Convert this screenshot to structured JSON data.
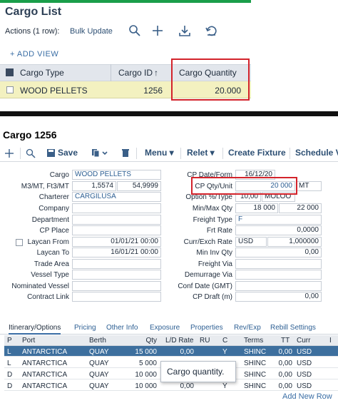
{
  "top": {
    "title": "Cargo List",
    "actions_label": "Actions (1 row):",
    "bulk_update": "Bulk Update",
    "add_view": "+ ADD VIEW",
    "columns": {
      "cargo_type": "Cargo Type",
      "cargo_id": "Cargo ID",
      "cargo_quantity": "Cargo Quantity"
    },
    "sort_indicator": "↑",
    "row": {
      "cargo_type": "WOOD PELLETS",
      "cargo_id": "1256",
      "cargo_quantity": "20.000"
    }
  },
  "bottom": {
    "title": "Cargo 1256",
    "toolbar": {
      "save": "Save",
      "menu": "Menu ▾",
      "relet": "Relet ▾",
      "create_fixture": "Create Fixture",
      "schedule": "Schedule V"
    },
    "left_fields": {
      "cargo_label": "Cargo",
      "cargo_value": "WOOD PELLETS",
      "m3mt_label": "M3/MT, Ft3/MT",
      "m3mt_value1": "1,5574",
      "m3mt_value2": "54,9999",
      "charterer_label": "Charterer",
      "charterer_value": "CARGILUSA",
      "company_label": "Company",
      "department_label": "Department",
      "cp_place_label": "CP Place",
      "laycan_from_label": "Laycan From",
      "laycan_from_value": "01/01/21 00:00",
      "laycan_to_label": "Laycan To",
      "laycan_to_value": "16/01/21 00:00",
      "trade_area_label": "Trade Area",
      "vessel_type_label": "Vessel Type",
      "nominated_vessel_label": "Nominated Vessel",
      "contract_link_label": "Contract Link"
    },
    "right_fields": {
      "cp_date_label": "CP Date/Form",
      "cp_date_value": "16/12/20",
      "cp_qty_label": "CP Qty/Unit",
      "cp_qty_value": "20 000",
      "cp_qty_unit": "MT",
      "option_label": "Option %/Type",
      "option_value": "10,00",
      "option_type": "MOLOO",
      "minmax_label": "Min/Max Qty",
      "min_value": "18 000",
      "max_value": "22 000",
      "freight_type_label": "Freight Type",
      "freight_type_value": "F",
      "frt_rate_label": "Frt Rate",
      "frt_rate_value": "0,0000",
      "curr_label": "Curr/Exch Rate",
      "curr_value": "USD",
      "exch_value": "1,000000",
      "min_inv_label": "Min Inv Qty",
      "min_inv_value": "0,00",
      "freight_via_label": "Freight Via",
      "demurrage_label": "Demurrage Via",
      "conf_date_label": "Conf Date (GMT)",
      "cp_draft_label": "CP Draft (m)",
      "cp_draft_value": "0,00"
    },
    "tabs": [
      "Itinerary/Options",
      "Pricing",
      "Other Info",
      "Exposure",
      "Properties",
      "Rev/Exp",
      "Rebill Settings"
    ],
    "table_headers": [
      "P",
      "Port",
      "Berth",
      "Qty",
      "L/D Rate",
      "RU",
      "C",
      "Terms",
      "TT",
      "Curr",
      "I"
    ],
    "rows": [
      {
        "p": "L",
        "port": "ANTARCTICA",
        "berth": "QUAY",
        "qty": "15 000",
        "rate": "0,00",
        "c": "Y",
        "terms": "SHINC",
        "tt": "0,00",
        "curr": "USD"
      },
      {
        "p": "L",
        "port": "ANTARCTICA",
        "berth": "QUAY",
        "qty": "5 000",
        "rate": "",
        "c": "",
        "terms": "SHINC",
        "tt": "0,00",
        "curr": "USD"
      },
      {
        "p": "D",
        "port": "ANTARCTICA",
        "berth": "QUAY",
        "qty": "10 000",
        "rate": "",
        "c": "",
        "terms": "SHINC",
        "tt": "0,00",
        "curr": "USD"
      },
      {
        "p": "D",
        "port": "ANTARCTICA",
        "berth": "QUAY",
        "qty": "10 000",
        "rate": "0,00",
        "c": "Y",
        "terms": "SHINC",
        "tt": "0,00",
        "curr": "USD"
      }
    ],
    "tooltip": "Cargo quantity.",
    "add_new_row": "Add New Row"
  },
  "colors": {
    "accent": "#3a6ea5",
    "highlight_box": "#d3232b",
    "selected_row": "#3d6f9e",
    "row_highlight": "#f3f1c0"
  }
}
